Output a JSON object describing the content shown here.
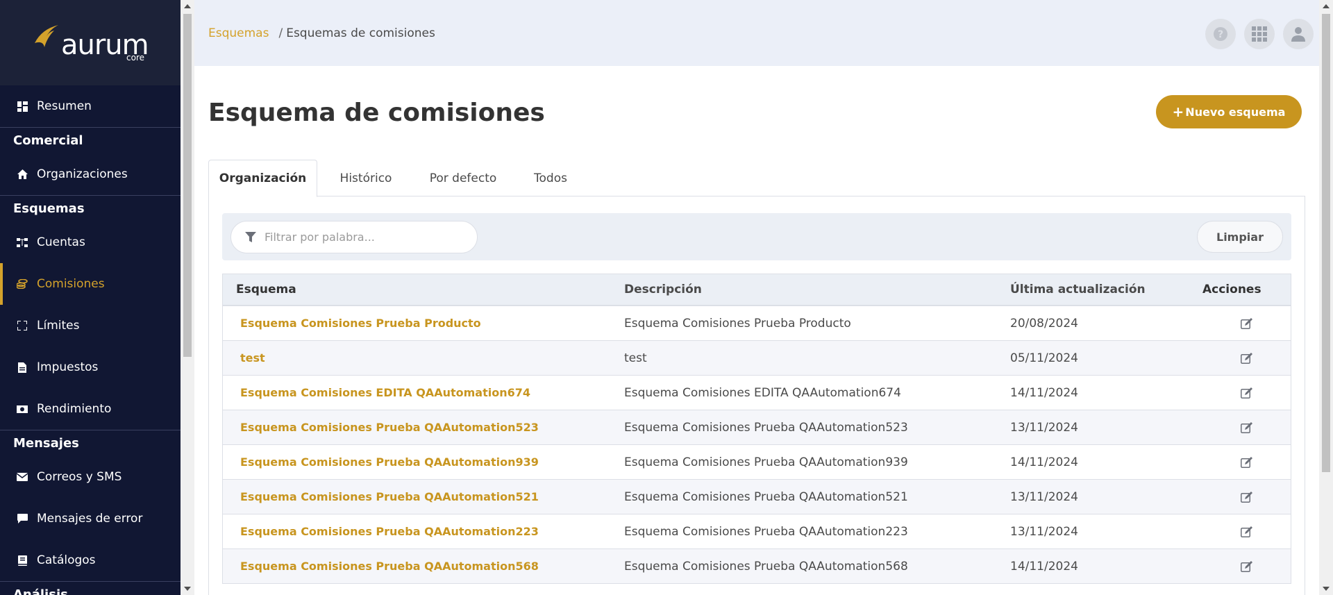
{
  "colors": {
    "accent": "#d4a22b",
    "sidebar": "#111733",
    "header": "#ebeff8"
  },
  "logo": {
    "text": "aurum",
    "sub": "core"
  },
  "sidebar": {
    "items": [
      {
        "label": "Resumen",
        "icon": "dashboard-icon"
      },
      {
        "section": "Comercial"
      },
      {
        "label": "Organizaciones",
        "icon": "home-icon"
      },
      {
        "section": "Esquemas"
      },
      {
        "label": "Cuentas",
        "icon": "sitemap-icon"
      },
      {
        "label": "Comisiones",
        "icon": "coins-icon",
        "active": true
      },
      {
        "label": "Límites",
        "icon": "expand-icon"
      },
      {
        "label": "Impuestos",
        "icon": "file-invoice-icon"
      },
      {
        "label": "Rendimiento",
        "icon": "money-bill-icon"
      },
      {
        "section": "Mensajes"
      },
      {
        "label": "Correos y SMS",
        "icon": "envelope-icon"
      },
      {
        "label": "Mensajes de error",
        "icon": "comment-icon"
      },
      {
        "label": "Catálogos",
        "icon": "book-icon"
      },
      {
        "section": "Análisis"
      }
    ]
  },
  "breadcrumb": {
    "root": "Esquemas",
    "separator": "/",
    "current": "Esquemas de comisiones"
  },
  "page": {
    "title": "Esquema de comisiones",
    "new_button": "Nuevo esquema"
  },
  "tabs": [
    "Organización",
    "Histórico",
    "Por defecto",
    "Todos"
  ],
  "filter": {
    "placeholder": "Filtrar por palabra...",
    "clear": "Limpiar"
  },
  "table": {
    "headers": [
      "Esquema",
      "Descripción",
      "Última actualización",
      "Acciones"
    ],
    "rows": [
      {
        "name": "Esquema Comisiones Prueba Producto",
        "desc": "Esquema Comisiones Prueba Producto",
        "date": "20/08/2024"
      },
      {
        "name": "test",
        "desc": "test",
        "date": "05/11/2024"
      },
      {
        "name": "Esquema Comisiones EDITA QAAutomation674",
        "desc": "Esquema Comisiones EDITA QAAutomation674",
        "date": "14/11/2024"
      },
      {
        "name": "Esquema Comisiones Prueba QAAutomation523",
        "desc": "Esquema Comisiones Prueba QAAutomation523",
        "date": "13/11/2024"
      },
      {
        "name": "Esquema Comisiones Prueba QAAutomation939",
        "desc": "Esquema Comisiones Prueba QAAutomation939",
        "date": "14/11/2024"
      },
      {
        "name": "Esquema Comisiones Prueba QAAutomation521",
        "desc": "Esquema Comisiones Prueba QAAutomation521",
        "date": "13/11/2024"
      },
      {
        "name": "Esquema Comisiones Prueba QAAutomation223",
        "desc": "Esquema Comisiones Prueba QAAutomation223",
        "date": "13/11/2024"
      },
      {
        "name": "Esquema Comisiones Prueba QAAutomation568",
        "desc": "Esquema Comisiones Prueba QAAutomation568",
        "date": "14/11/2024"
      }
    ]
  }
}
